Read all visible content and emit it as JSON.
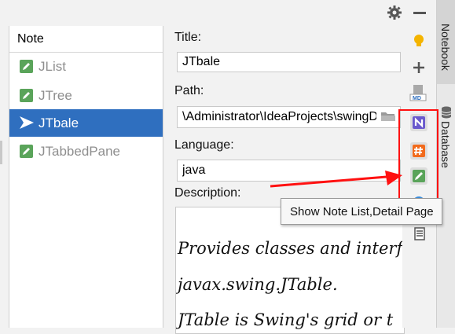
{
  "topbar": {
    "settings_icon": "gear-icon",
    "minimize_icon": "minus-icon"
  },
  "note_list": {
    "header": "Note",
    "items": [
      {
        "label": "JList",
        "icon": "note-icon"
      },
      {
        "label": "JTree",
        "icon": "note-icon"
      },
      {
        "label": "JTbale",
        "icon": "arrow-right-icon",
        "selected": true
      },
      {
        "label": "JTabbedPane",
        "icon": "note-icon"
      }
    ]
  },
  "detail": {
    "title_label": "Title:",
    "title_value": "JTbale",
    "path_label": "Path:",
    "path_value": "\\Administrator\\IdeaProjects\\swingD",
    "language_label": "Language:",
    "language_value": "java",
    "description_label": "Description:",
    "description_lines": [
      "Provides classes and interf",
      "javax.swing.JTable.",
      "JTable is Swing's grid or t",
      "  "
    ]
  },
  "toolbar": {
    "buttons": [
      "lightbulb-icon",
      "plus-icon",
      "markdown-icon",
      "onenote-icon",
      "hash-icon",
      "edit-note-icon",
      "globe-icon",
      "list-icon"
    ]
  },
  "side_tabs": {
    "notebook": "Notebook",
    "database": "Database"
  },
  "tooltip": {
    "text": "Show Note List,Detail Page"
  },
  "colors": {
    "selection": "#2f6fbf",
    "annotation": "#ff1111",
    "note_green": "#5aa45a"
  }
}
